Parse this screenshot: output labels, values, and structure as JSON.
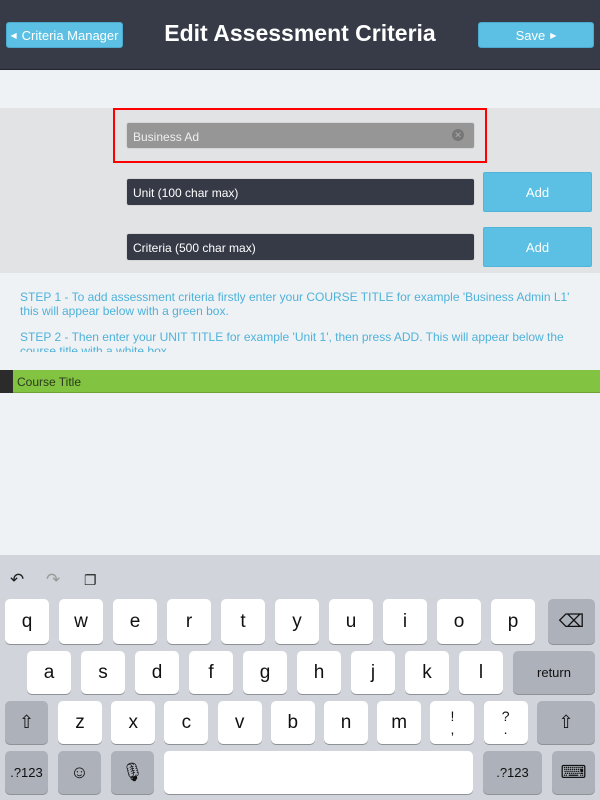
{
  "header": {
    "back_label": "Criteria Manager",
    "title": "Edit Assessment Criteria",
    "save_label": "Save"
  },
  "form": {
    "course_value": "Business Ad",
    "unit_placeholder": "Unit (100 char max)",
    "criteria_placeholder": "Criteria (500 char max)",
    "add_unit_label": "Add",
    "add_criteria_label": "Add"
  },
  "instructions": {
    "step1": "STEP 1 - To add assessment criteria firstly enter your COURSE TITLE for example 'Business Admin L1' this will appear below with a green box.",
    "step2": "STEP 2 - Then enter your UNIT TITLE for example 'Unit 1', then press ADD. This will appear below the course title with a white box."
  },
  "course_list": {
    "header": "Course Title"
  },
  "colors": {
    "header": "#363b47",
    "accent": "#5bc0e3",
    "course_bar": "#82c341",
    "highlight": "#ff0000"
  },
  "keyboard": {
    "toolbar": [
      "undo-icon",
      "redo-icon",
      "paste-icon"
    ],
    "rows": [
      [
        "q",
        "w",
        "e",
        "r",
        "t",
        "y",
        "u",
        "i",
        "o",
        "p",
        "⌫"
      ],
      [
        "a",
        "s",
        "d",
        "f",
        "g",
        "h",
        "j",
        "k",
        "l",
        "return"
      ],
      [
        "⇧",
        "z",
        "x",
        "c",
        "v",
        "b",
        "n",
        "m",
        "!\n,",
        "?\n.",
        "⇧"
      ],
      [
        ".?123",
        "☺",
        "🎙",
        " ",
        ".?123",
        "⌨"
      ]
    ]
  }
}
